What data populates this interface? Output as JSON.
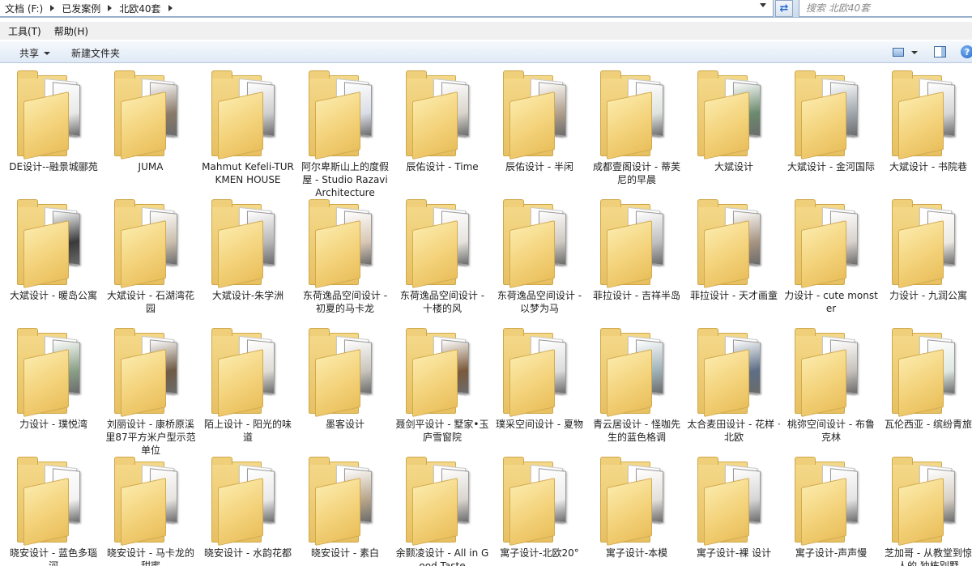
{
  "address": {
    "crumbs": [
      "文档 (F:)",
      "已发案例",
      "北欧40套"
    ]
  },
  "search": {
    "placeholder": "搜索 北欧40套"
  },
  "menu": {
    "tools": "工具(T)",
    "help": "帮助(H)"
  },
  "toolbar": {
    "share": "共享",
    "new_folder": "新建文件夹"
  },
  "icons": {
    "refresh": "refresh-icon",
    "view": "view-options-icon",
    "preview_pane": "preview-pane-icon",
    "help": "help-icon",
    "folder": "folder-icon"
  },
  "colors": {
    "folder": "#f3d27a",
    "address_bg": "#dde7f2",
    "command_bar": "#dfe9f5",
    "help_icon": "#1f63c8"
  },
  "folders": [
    {
      "name": "DE设计--融景城郦苑",
      "thumb": "#e8e8e8"
    },
    {
      "name": "JUMA",
      "thumb": "#8a7a6a"
    },
    {
      "name": "Mahmut Kefeli-TURKMEN HOUSE",
      "thumb": "#cfcfcf"
    },
    {
      "name": "阿尔卑斯山上的度假屋 - Studio Razavi Architecture",
      "thumb": "#d9dde6"
    },
    {
      "name": "辰佑设计 - Time",
      "thumb": "#d8d4cc"
    },
    {
      "name": "辰佑设计 - 半闲",
      "thumb": "#b09f8c"
    },
    {
      "name": "成都壹阁设计 - 蒂芙尼的早晨",
      "thumb": "#dfe3df"
    },
    {
      "name": "大斌设计",
      "thumb": "#6b8a6e"
    },
    {
      "name": "大斌设计 - 金河国际",
      "thumb": "#9fa7ae"
    },
    {
      "name": "大斌设计 - 书院巷",
      "thumb": "#d6d6d6"
    },
    {
      "name": "大斌设计 - 暖岛公寓",
      "thumb": "#3a3a3a"
    },
    {
      "name": "大斌设计 - 石湖湾花园",
      "thumb": "#cbbfae"
    },
    {
      "name": "大斌设计-朱学洲",
      "thumb": "#b7b7b7"
    },
    {
      "name": "东荷逸品空间设计 - 初夏的马卡龙",
      "thumb": "#d8c8b5"
    },
    {
      "name": "东荷逸品空间设计 - 十楼的风",
      "thumb": "#e6e3de"
    },
    {
      "name": "东荷逸品空间设计 - 以梦为马",
      "thumb": "#cfcac2"
    },
    {
      "name": "菲拉设计 - 吉祥半岛",
      "thumb": "#bfbfbf"
    },
    {
      "name": "菲拉设计 - 天才画童",
      "thumb": "#a69482"
    },
    {
      "name": "力设计 - cute monster",
      "thumb": "#d9d2cc"
    },
    {
      "name": "力设计 - 九润公寓",
      "thumb": "#ece9e2"
    },
    {
      "name": "力设计 - 璞悦湾",
      "thumb": "#8aa088"
    },
    {
      "name": "刘丽设计 - 康桥原溪里87平方米户型示范单位",
      "thumb": "#6f5a45"
    },
    {
      "name": "陌上设计 - 阳光的味道",
      "thumb": "#e0ddd6"
    },
    {
      "name": "墨客设计",
      "thumb": "#c9c5bd"
    },
    {
      "name": "聂剑平设计 - 墅家•玉庐雪窗院",
      "thumb": "#7b5a3a"
    },
    {
      "name": "璞采空间设计 - 夏物",
      "thumb": "#dcdcdc"
    },
    {
      "name": "青云居设计 - 怪咖先生的蓝色格调",
      "thumb": "#9fb2b8"
    },
    {
      "name": "太合麦田设计 - 花样 · 北欧",
      "thumb": "#5d6f86"
    },
    {
      "name": "桃弥空间设计 - 布鲁克林",
      "thumb": "#c7c2bb"
    },
    {
      "name": "瓦伦西亚 - 缤纷青旅",
      "thumb": "#dfe8e2"
    },
    {
      "name": "晓安设计 - 蓝色多瑙河",
      "thumb": "#f2f2f2"
    },
    {
      "name": "晓安设计 - 马卡龙的甜蜜",
      "thumb": "#e7e4df"
    },
    {
      "name": "晓安设计 - 水韵花都",
      "thumb": "#e9e9e9"
    },
    {
      "name": "晓安设计 - 素白",
      "thumb": "#b8a58a"
    },
    {
      "name": "余颢凌设计 - All in Good Taste",
      "thumb": "#d9d5cf"
    },
    {
      "name": "寓子设计-北欧20°",
      "thumb": "#ededed"
    },
    {
      "name": "寓子设计-本模",
      "thumb": "#e3e0da"
    },
    {
      "name": "寓子设计-裸 设计",
      "thumb": "#d6d6d6"
    },
    {
      "name": "寓子设计-声声慢",
      "thumb": "#e4e4e4"
    },
    {
      "name": "芝加哥 - 从教堂到惊人的,独栋别墅",
      "thumb": "#d7cfc4"
    }
  ]
}
